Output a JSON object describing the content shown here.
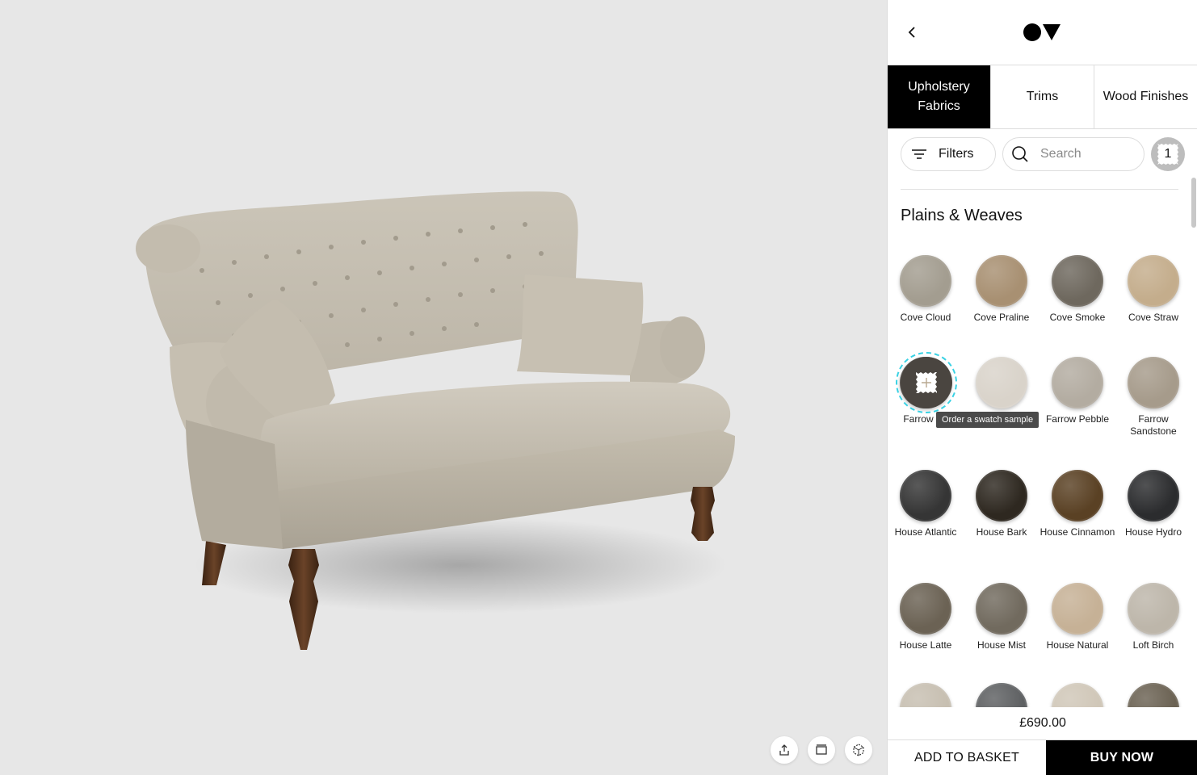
{
  "panel": {
    "tabs": [
      {
        "label": "Upholstery Fabrics",
        "active": true
      },
      {
        "label": "Trims",
        "active": false
      },
      {
        "label": "Wood Finishes",
        "active": false
      }
    ],
    "filters_label": "Filters",
    "search_placeholder": "Search",
    "swatch_count": "1",
    "section_title": "Plains & Weaves",
    "tooltip": "Order a swatch sample",
    "swatches": [
      {
        "name": "Cove Cloud",
        "color": "#a39d90"
      },
      {
        "name": "Cove Praline",
        "color": "#a89072"
      },
      {
        "name": "Cove Smoke",
        "color": "#6e685e"
      },
      {
        "name": "Cove Straw",
        "color": "#c4ad8c"
      },
      {
        "name": "Farrow Ba",
        "color": "#4a4540"
      },
      {
        "name": "",
        "color": "#d9d3ca"
      },
      {
        "name": "Farrow Pebble",
        "color": "#b3aca1"
      },
      {
        "name": "Farrow Sandstone",
        "color": "#a69b8b"
      },
      {
        "name": "House Atlantic",
        "color": "#353535"
      },
      {
        "name": "House Bark",
        "color": "#2e2820"
      },
      {
        "name": "House Cinnamon",
        "color": "#5a4124"
      },
      {
        "name": "House Hydro",
        "color": "#2b2c2e"
      },
      {
        "name": "House Latte",
        "color": "#6b6254"
      },
      {
        "name": "House Mist",
        "color": "#716a5e"
      },
      {
        "name": "House Natural",
        "color": "#c6b196"
      },
      {
        "name": "Loft Birch",
        "color": "#bdb6aa"
      },
      {
        "name": "",
        "color": "#c7bfb1"
      },
      {
        "name": "",
        "color": "#5e6062"
      },
      {
        "name": "",
        "color": "#d0c7b8"
      },
      {
        "name": "",
        "color": "#6b6253"
      }
    ]
  },
  "price": "£690.00",
  "actions": {
    "add_to_basket": "ADD TO BASKET",
    "buy_now": "BUY NOW"
  },
  "viewer": {
    "fabric_color": "#c9c3b6",
    "leg_color": "#4a2c18"
  }
}
